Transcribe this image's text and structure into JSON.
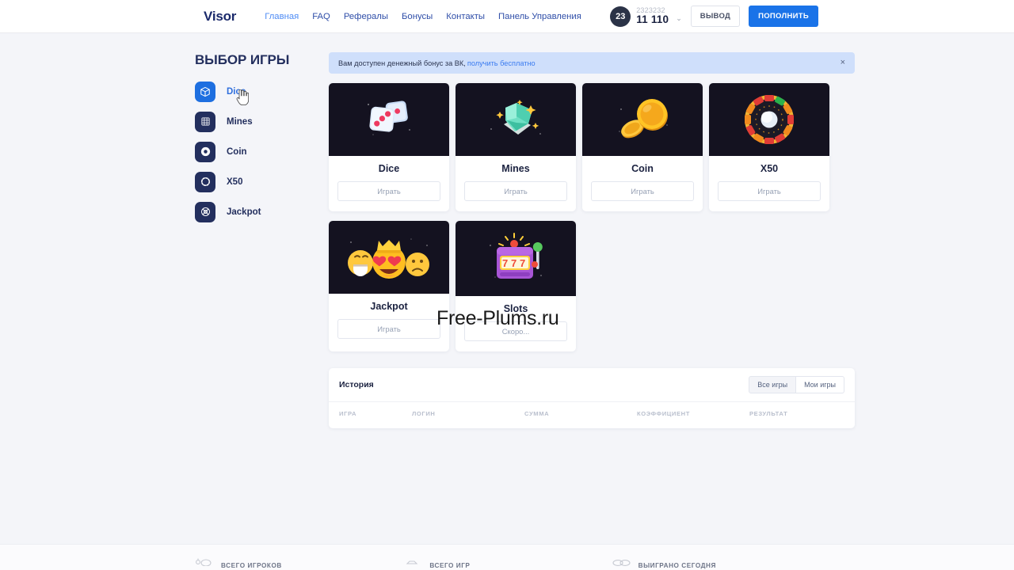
{
  "header": {
    "logo": "Visor",
    "nav": [
      {
        "label": "Главная",
        "active": true
      },
      {
        "label": "FAQ",
        "active": false
      },
      {
        "label": "Рефералы",
        "active": false
      },
      {
        "label": "Бонусы",
        "active": false
      },
      {
        "label": "Контакты",
        "active": false
      },
      {
        "label": "Панель Управления",
        "active": false
      }
    ],
    "account": {
      "level": "23",
      "username": "2323232",
      "balance": "11 110",
      "caret": "⌄"
    },
    "withdraw_label": "ВЫВОД",
    "deposit_label": "ПОПОЛНИТЬ",
    "accent_color": "#1a73e8"
  },
  "sidebar": {
    "title": "ВЫБОР ИГРЫ",
    "items": [
      {
        "label": "Dice",
        "icon": "cube-icon",
        "active": true
      },
      {
        "label": "Mines",
        "icon": "grid-icon",
        "active": false
      },
      {
        "label": "Coin",
        "icon": "coin-icon",
        "active": false
      },
      {
        "label": "X50",
        "icon": "dashed-circle-icon",
        "active": false
      },
      {
        "label": "Jackpot",
        "icon": "target-icon",
        "active": false
      }
    ]
  },
  "banner": {
    "text": "Вам доступен денежный бонус за ВК,",
    "link": "получить бесплатно",
    "close": "×"
  },
  "games": [
    {
      "title": "Dice",
      "button": "Играть",
      "art": "dice"
    },
    {
      "title": "Mines",
      "button": "Играть",
      "art": "gem"
    },
    {
      "title": "Coin",
      "button": "Играть",
      "art": "coin"
    },
    {
      "title": "X50",
      "button": "Играть",
      "art": "wheel"
    },
    {
      "title": "Jackpot",
      "button": "Играть",
      "art": "emoji"
    },
    {
      "title": "Slots",
      "button": "Скоро...",
      "art": "slots"
    }
  ],
  "history": {
    "title": "История",
    "tabs": [
      "Все игры",
      "Мои игры"
    ],
    "columns": [
      "ИГРА",
      "ЛОГИН",
      "СУММА",
      "КОЭФФИЦИЕНТ",
      "РЕЗУЛЬТАТ"
    ]
  },
  "footer_stats": [
    {
      "label": "ВСЕГО ИГРОКОВ",
      "icon": "users-icon"
    },
    {
      "label": "ВСЕГО ИГР",
      "icon": "dice-stat-icon"
    },
    {
      "label": "ВЫИГРАНО СЕГОДНЯ",
      "icon": "coins-stat-icon"
    }
  ],
  "watermark": "Free-Plums.ru"
}
